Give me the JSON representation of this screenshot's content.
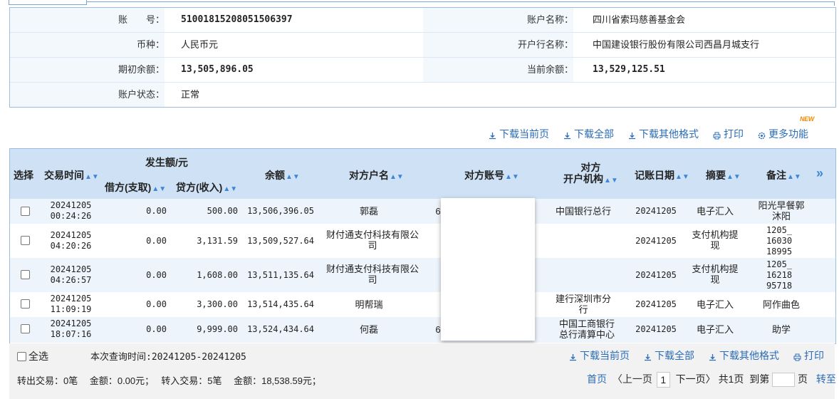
{
  "account": {
    "account_no_label": "账　　号：",
    "account_no": "51001815208051506397",
    "account_name_label": "账户名称：",
    "account_name": "四川省索玛慈善基金会",
    "currency_label": "币种：",
    "currency": "人民币元",
    "bank_name_label": "开户行名称：",
    "bank_name": "中国建设银行股份有限公司西昌月城支行",
    "opening_balance_label": "期初余额：",
    "opening_balance": "13,505,896.05",
    "current_balance_label": "当前余额：",
    "current_balance": "13,529,125.51",
    "status_label": "账户状态：",
    "status": "正常"
  },
  "toolbar": {
    "download_current": "下载当前页",
    "download_all": "下载全部",
    "download_other": "下载其他格式",
    "print": "打印",
    "more": "更多功能",
    "new_badge": "NEW"
  },
  "table": {
    "headers": {
      "select": "选择",
      "time": "交易时间",
      "amount_group": "发生额/元",
      "debit": "借方(支取)",
      "credit": "贷方(收入)",
      "balance": "余额",
      "cp_name": "对方户名",
      "cp_account": "对方账号",
      "cp_bank_1": "对方",
      "cp_bank_2": "开户机构",
      "post_date": "记账日期",
      "summary": "摘要",
      "remark": "备注",
      "more": "»"
    },
    "rows": [
      {
        "date": "20241205",
        "time": "00:24:26",
        "debit": "0.00",
        "credit": "500.00",
        "balance": "13,506,396.05",
        "cp_name_1": "郭磊",
        "cp_name_2": "",
        "cp_account": "6",
        "cp_bank_1": "中国银行总行",
        "cp_bank_2": "",
        "post_date": "20241205",
        "summary_1": "电子汇入",
        "summary_2": "",
        "remark_1": "阳光早餐郭",
        "remark_2": "沐阳",
        "remark_3": ""
      },
      {
        "date": "20241205",
        "time": "04:20:26",
        "debit": "0.00",
        "credit": "3,131.59",
        "balance": "13,509,527.64",
        "cp_name_1": "财付通支付科技有限公",
        "cp_name_2": "司",
        "cp_account": "",
        "cp_bank_1": "",
        "cp_bank_2": "",
        "post_date": "20241205",
        "summary_1": "支付机构提",
        "summary_2": "现",
        "remark_1": "1205_",
        "remark_2": "16030",
        "remark_3": "18995"
      },
      {
        "date": "20241205",
        "time": "04:26:57",
        "debit": "0.00",
        "credit": "1,608.00",
        "balance": "13,511,135.64",
        "cp_name_1": "财付通支付科技有限公",
        "cp_name_2": "司",
        "cp_account": "",
        "cp_bank_1": "",
        "cp_bank_2": "",
        "post_date": "20241205",
        "summary_1": "支付机构提",
        "summary_2": "现",
        "remark_1": "1205_",
        "remark_2": "16218",
        "remark_3": "95718"
      },
      {
        "date": "20241205",
        "time": "11:09:19",
        "debit": "0.00",
        "credit": "3,300.00",
        "balance": "13,514,435.64",
        "cp_name_1": "明帮瑞",
        "cp_name_2": "",
        "cp_account": "",
        "cp_bank_1": "建行深圳市分",
        "cp_bank_2": "行",
        "post_date": "20241205",
        "summary_1": "电子汇入",
        "summary_2": "",
        "remark_1": "阿作曲色",
        "remark_2": "",
        "remark_3": ""
      },
      {
        "date": "20241205",
        "time": "18:07:16",
        "debit": "0.00",
        "credit": "9,999.00",
        "balance": "13,524,434.64",
        "cp_name_1": "何磊",
        "cp_name_2": "",
        "cp_account": "6",
        "cp_bank_1": "中国工商银行",
        "cp_bank_2": "总行清算中心",
        "post_date": "20241205",
        "summary_1": "电子汇入",
        "summary_2": "",
        "remark_1": "助学",
        "remark_2": "",
        "remark_3": ""
      }
    ]
  },
  "footer": {
    "select_all": "全选",
    "query_time": "本次查询时间:20241205-20241205",
    "download_current": "下载当前页",
    "download_all": "下载全部",
    "download_other": "下载其他格式",
    "print": "打印",
    "summary": "转出交易：0笔　 金额：0.00元；　 转入交易：5笔　 金额：18,538.59元；",
    "first": "首页",
    "prev": "〈上一页",
    "page": "1",
    "next": "下一页〉",
    "total": "共1页",
    "goto": "到第",
    "page_unit": "页",
    "go": "转至"
  },
  "colors": {
    "link": "#2a6cb8",
    "header_bg": "#cfe2f5",
    "border": "#9dbce0",
    "sort_arrow": "#3d86d6"
  }
}
